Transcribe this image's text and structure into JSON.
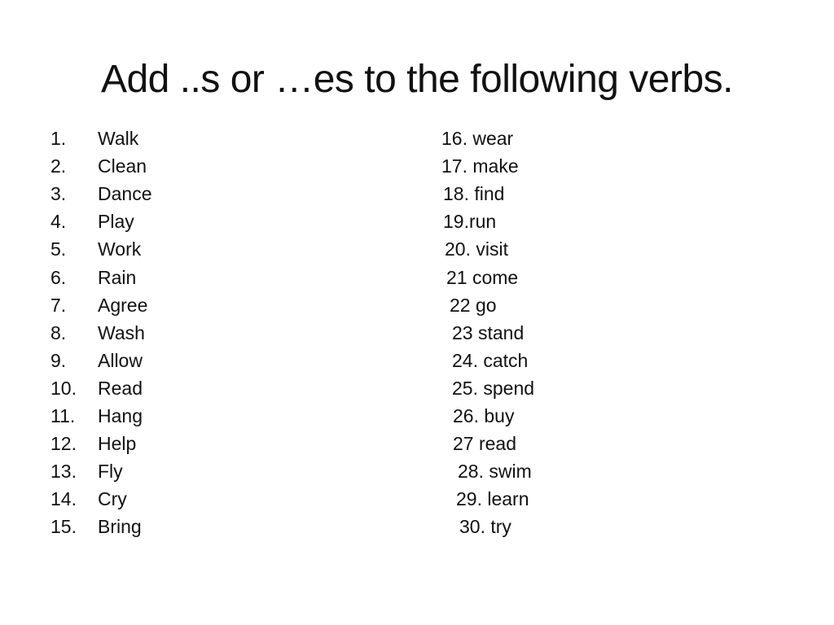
{
  "title": "Add ..s  or …es to the following verbs.",
  "left_list": [
    {
      "num": "1.",
      "word": "Walk"
    },
    {
      "num": "2.",
      "word": "Clean"
    },
    {
      "num": "3.",
      "word": "Dance"
    },
    {
      "num": "4.",
      "word": "Play"
    },
    {
      "num": "5.",
      "word": "Work"
    },
    {
      "num": "6.",
      "word": "Rain"
    },
    {
      "num": "7.",
      "word": "Agree"
    },
    {
      "num": "8.",
      "word": "Wash"
    },
    {
      "num": "9.",
      "word": "Allow"
    },
    {
      "num": "10.",
      "word": "Read"
    },
    {
      "num": "11.",
      "word": "Hang"
    },
    {
      "num": "12.",
      "word": "Help"
    },
    {
      "num": "13.",
      "word": "Fly"
    },
    {
      "num": "14.",
      "word": "Cry"
    },
    {
      "num": "15.",
      "word": "Bring"
    }
  ],
  "right_list": [
    "16. wear",
    "17. make",
    "18. find",
    "19.run",
    "20. visit",
    "21 come",
    "22 go",
    "23 stand",
    "24. catch",
    "25. spend",
    "26. buy",
    "27 read",
    "28. swim",
    "29. learn",
    "30. try"
  ]
}
